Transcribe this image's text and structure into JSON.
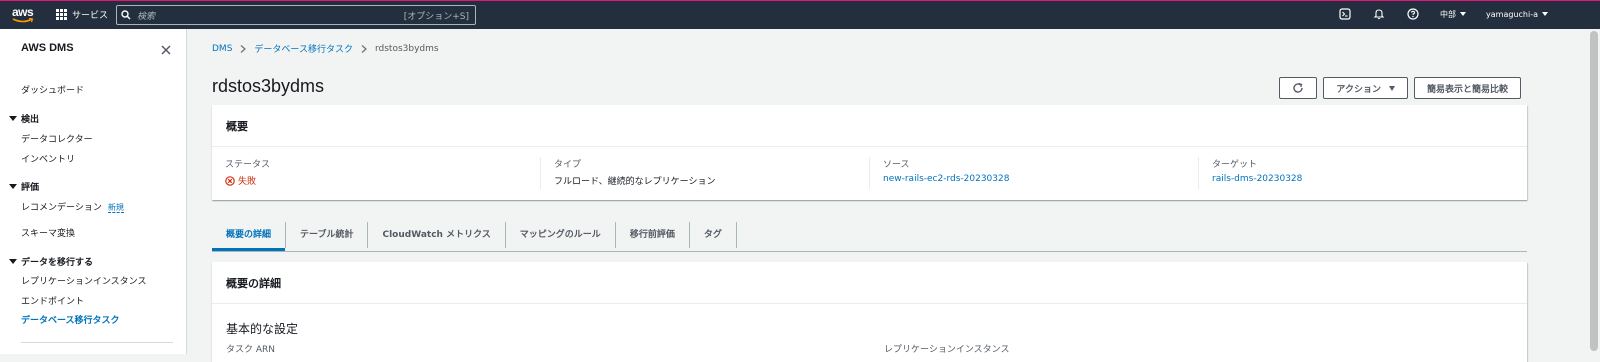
{
  "topbar": {
    "logo": "aws",
    "services_label": "サービス",
    "search_placeholder": "検索",
    "search_hint": "[オプション+S]",
    "region": "中部",
    "user": "yamaguchi-a",
    "accent_color": "#e7157b"
  },
  "sidebar": {
    "title": "AWS DMS",
    "dashboard": "ダッシュボード",
    "group_discover": "検出",
    "data_collector": "データコレクター",
    "inventory": "インベントリ",
    "group_assess": "評価",
    "recommendation": "レコメンデーション",
    "new_badge": "新規",
    "schema_conversion": "スキーマ変換",
    "group_migrate": "データを移行する",
    "replication_instances": "レプリケーションインスタンス",
    "endpoints": "エンドポイント",
    "db_migration_tasks": "データベース移行タスク"
  },
  "breadcrumb": {
    "root": "DMS",
    "parent": "データベース移行タスク",
    "current": "rdstos3bydms"
  },
  "page": {
    "title": "rdstos3bydms",
    "action_label": "アクション",
    "compare_label": "簡易表示と簡易比較"
  },
  "summary": {
    "heading": "概要",
    "status_label": "ステータス",
    "status_value": "失敗",
    "type_label": "タイプ",
    "type_value": "フルロード、継続的なレプリケーション",
    "source_label": "ソース",
    "source_value": "new-rails-ec2-rds-20230328",
    "target_label": "ターゲット",
    "target_value": "rails-dms-20230328"
  },
  "tabs": [
    "概要の詳細",
    "テーブル統計",
    "CloudWatch メトリクス",
    "マッピングのルール",
    "移行前評価",
    "タグ"
  ],
  "details": {
    "heading": "概要の詳細",
    "basic_settings": "基本的な設定",
    "task_arn_label": "タスク ARN",
    "replication_instance_label": "レプリケーションインスタンス"
  }
}
